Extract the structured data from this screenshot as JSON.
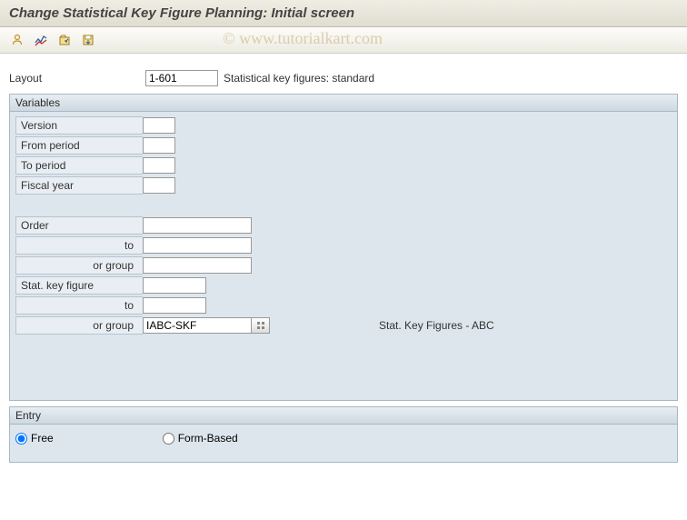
{
  "header": {
    "title": "Change Statistical Key Figure Planning: Initial screen"
  },
  "watermark": "© www.tutorialkart.com",
  "toolbar": {
    "icons": [
      "person-icon",
      "chart-icon",
      "open-icon",
      "save-icon"
    ]
  },
  "layout": {
    "label": "Layout",
    "value": "1-601",
    "description": "Statistical key figures: standard"
  },
  "variables": {
    "title": "Variables",
    "fields": {
      "version_label": "Version",
      "version_value": "",
      "from_period_label": "From period",
      "from_period_value": "",
      "to_period_label": "To period",
      "to_period_value": "",
      "fiscal_year_label": "Fiscal year",
      "fiscal_year_value": "",
      "order_label": "Order",
      "order_value": "",
      "order_to_label": "to",
      "order_to_value": "",
      "order_group_label": "or group",
      "order_group_value": "",
      "stat_label": "Stat. key figure",
      "stat_value": "",
      "stat_to_label": "to",
      "stat_to_value": "",
      "stat_group_label": "or group",
      "stat_group_value": "IABC-SKF",
      "stat_group_desc": "Stat. Key Figures - ABC"
    }
  },
  "entry": {
    "title": "Entry",
    "options": {
      "free": "Free",
      "form": "Form-Based"
    },
    "selected": "free"
  }
}
